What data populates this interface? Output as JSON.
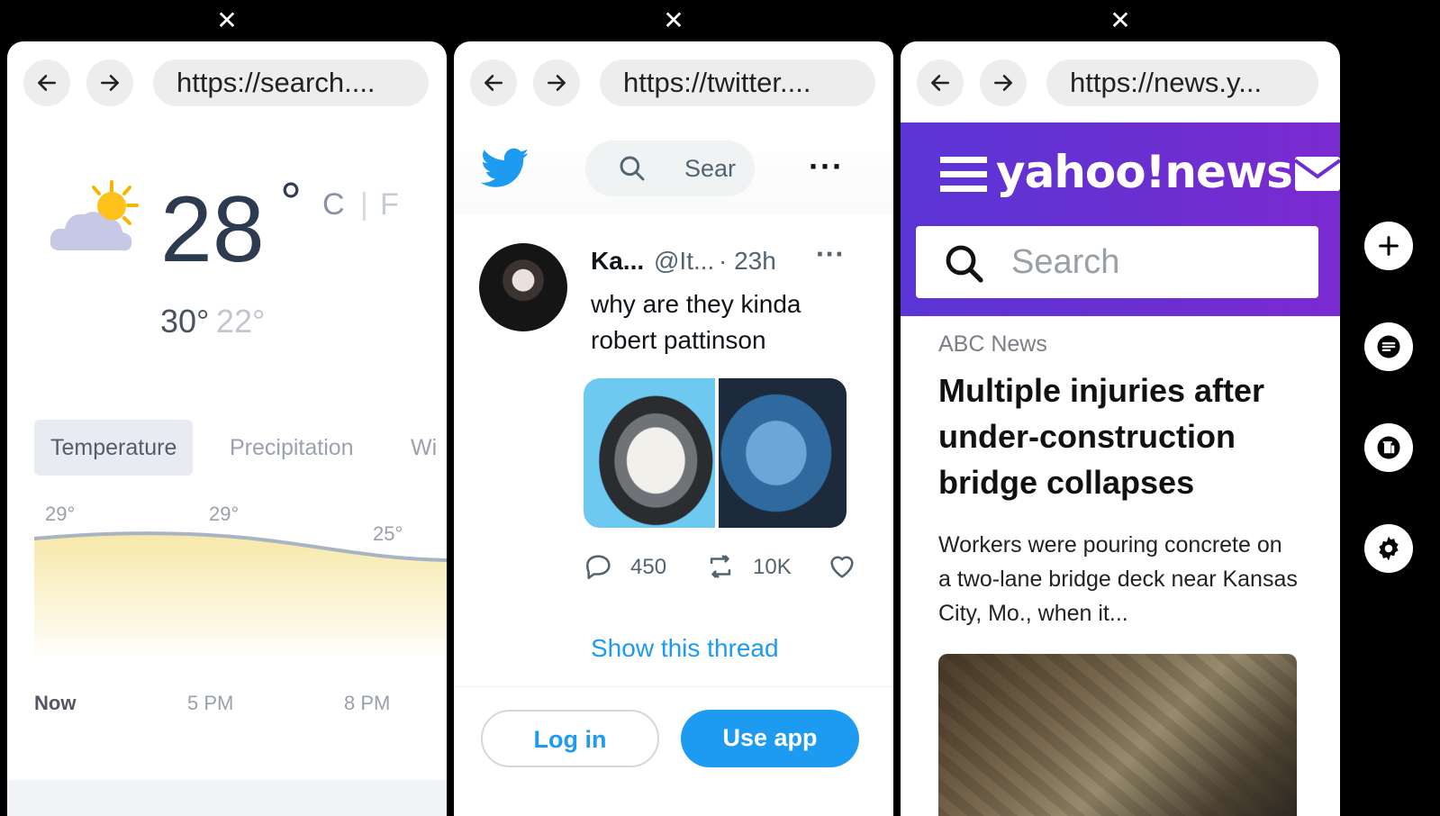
{
  "tabs": [
    {
      "close_icon": "close-icon",
      "url": "https://search...."
    },
    {
      "close_icon": "close-icon",
      "url": "https://twitter...."
    },
    {
      "close_icon": "close-icon",
      "url": "https://news.y..."
    }
  ],
  "side_controls": [
    "plus-icon",
    "list-icon",
    "trash-icon",
    "gear-icon"
  ],
  "weather": {
    "temperature": "28",
    "degree": "°",
    "unit_c": "C",
    "unit_sep": "|",
    "unit_f": "F",
    "high": "30°",
    "low": "22°",
    "tabs": [
      "Temperature",
      "Precipitation",
      "Wi"
    ],
    "chart_labels": [
      "29°",
      "29°",
      "25°"
    ],
    "times": [
      "Now",
      "5 PM",
      "8 PM"
    ]
  },
  "twitter": {
    "search_placeholder": "Sear",
    "name": "Ka...",
    "handle": "@It...",
    "time": "· 23h",
    "text": "why are they kinda robert pattinson",
    "replies": "450",
    "retweets": "10K",
    "show_thread": "Show this thread",
    "login": "Log in",
    "use_app": "Use app"
  },
  "yahoo": {
    "logo": "yahoo!news",
    "search_placeholder": "Search",
    "source": "ABC News",
    "headline": "Multiple injuries after under-construction bridge collapses",
    "summary": "Workers were pouring concrete on a two-lane bridge deck near Kansas City, Mo., when it..."
  },
  "colors": {
    "twitter_blue": "#1d9bf0",
    "yahoo_purple": "#6a2fd0"
  }
}
